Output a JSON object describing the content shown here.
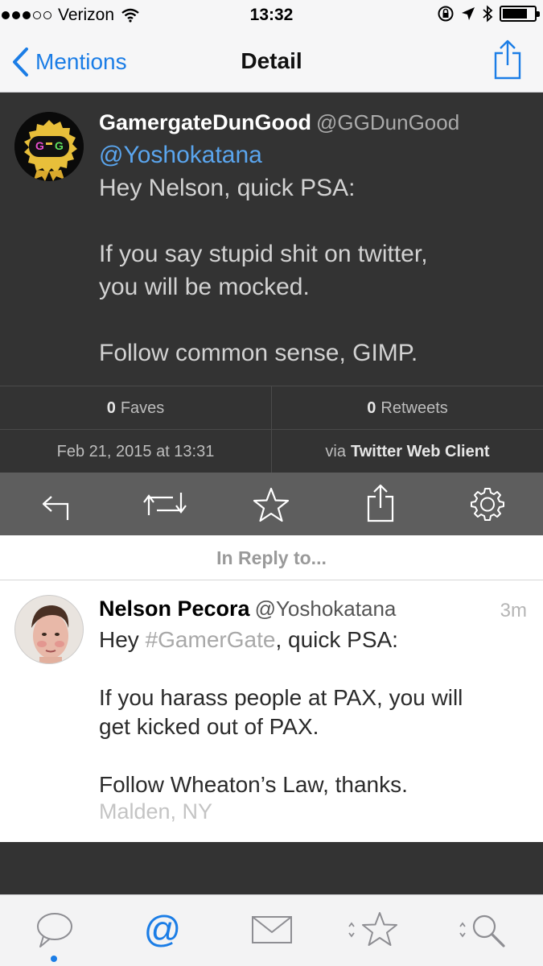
{
  "status_bar": {
    "carrier": "Verizon",
    "time": "13:32",
    "signal_bars_filled": 3,
    "signal_bars_total": 5,
    "battery_level": 0.7
  },
  "nav": {
    "back_label": "Mentions",
    "title": "Detail",
    "accent_color": "#1b7de6"
  },
  "main_tweet": {
    "display_name": "GamergateDunGood",
    "handle": "@GGDunGood",
    "mention": "@Yoshokatana",
    "line1": "Hey Nelson, quick PSA:",
    "line2": "If you say stupid shit on twitter,",
    "line3": "you will be mocked.",
    "line4": "Follow common sense, GIMP.",
    "avatar_text": "G G"
  },
  "stats": {
    "faves_count": "0",
    "faves_label": "Faves",
    "retweets_count": "0",
    "retweets_label": "Retweets",
    "date": "Feb 21, 2015 at 13:31",
    "via_prefix": "via",
    "via_client": "Twitter Web Client"
  },
  "actions": [
    "reply-icon",
    "retweet-icon",
    "star-icon",
    "share-icon",
    "gear-icon"
  ],
  "reply_header": "In Reply to...",
  "reply_tweet": {
    "display_name": "Nelson Pecora",
    "handle": "@Yoshokatana",
    "time": "3m",
    "line1_prefix": "Hey ",
    "hashtag": "#GamerGate",
    "line1_suffix": ", quick PSA:",
    "line2": "If you harass people at PAX, you will",
    "line3": "get kicked out of PAX.",
    "line4": "Follow Wheaton’s Law, thanks.",
    "location": "Malden, NY"
  },
  "tab_bar": {
    "tabs": [
      "chat-icon",
      "at-icon",
      "mail-icon",
      "favorites-icon",
      "search-icon"
    ],
    "active_tab": "at-icon"
  }
}
